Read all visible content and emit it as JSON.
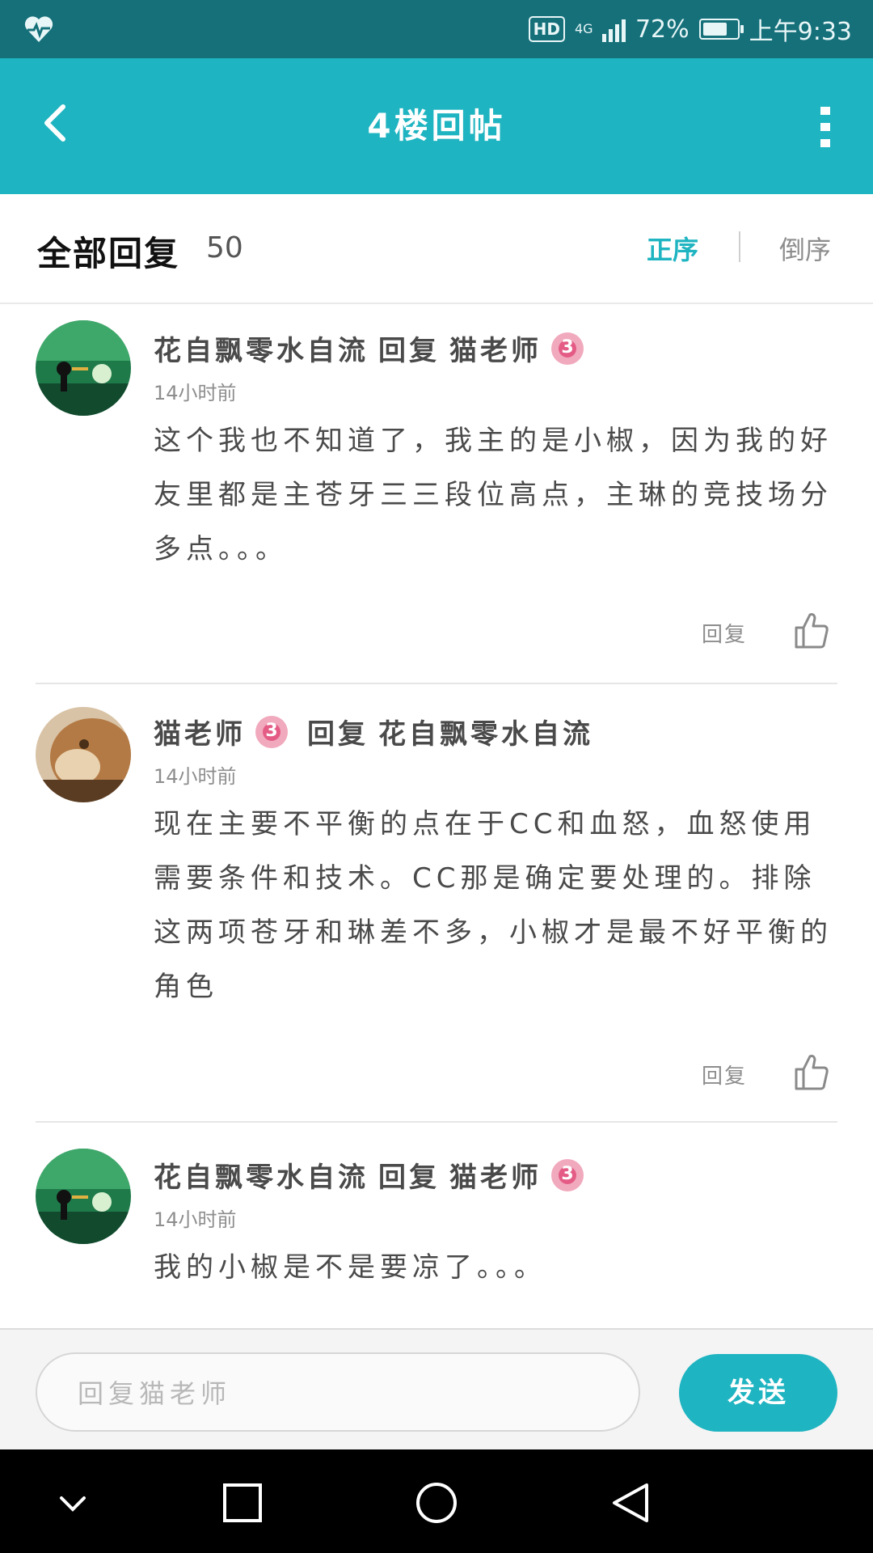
{
  "status_bar": {
    "hd": "HD",
    "network": "4G",
    "battery": "72%",
    "battery_level": 0.72,
    "time": "上午9:33",
    "icons": [
      "heart-pulse-icon",
      "signal-icon",
      "battery-icon"
    ]
  },
  "app_bar": {
    "title": "4楼回帖",
    "icons": [
      "back-arrow-icon",
      "more-vertical-icon"
    ]
  },
  "header": {
    "label": "全部回复",
    "count": "50",
    "sort_asc": "正序",
    "sort_desc": "倒序"
  },
  "colors": {
    "accent": "#1fb4c1",
    "status": "#15707a",
    "level": "#e45c86"
  },
  "comments": [
    {
      "author": "花自飘零水自流",
      "reply_word": "回复",
      "target": "猫老师",
      "level": "3",
      "time": "14小时前",
      "text": "这个我也不知道了，我主的是小椒，因为我的好友里都是主苍牙三三段位高点，主琳的竞技场分多点。。。",
      "reply_label": "回复"
    },
    {
      "author": "猫老师",
      "level": "3",
      "reply_word": "回复",
      "target": "花自飘零水自流",
      "time": "14小时前",
      "text": "现在主要不平衡的点在于CC和血怒，血怒使用需要条件和技术。CC那是确定要处理的。排除这两项苍牙和琳差不多，小椒才是最不好平衡的角色",
      "reply_label": "回复"
    },
    {
      "author": "花自飘零水自流",
      "reply_word": "回复",
      "target": "猫老师",
      "level": "3",
      "time": "14小时前",
      "text": "我的小椒是不是要凉了。。。"
    }
  ],
  "composer": {
    "placeholder": "回复猫老师",
    "send_label": "发送"
  },
  "nav_bar": {
    "icons": [
      "chevron-down-icon",
      "square-icon",
      "circle-icon",
      "triangle-back-icon"
    ]
  }
}
